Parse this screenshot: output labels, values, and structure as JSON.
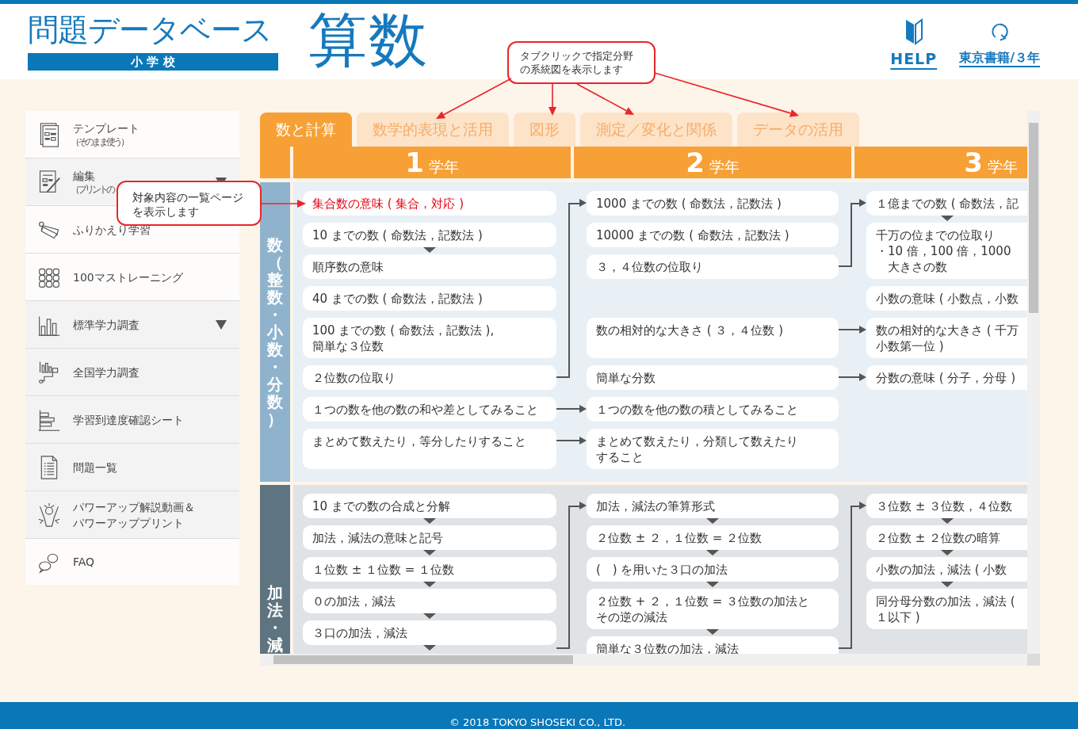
{
  "header": {
    "logo_title": "問題データベース",
    "logo_subtitle": "小 学 校",
    "subject": "算数",
    "links": [
      {
        "label": "HELP"
      },
      {
        "label": "東京書籍/３年"
      }
    ]
  },
  "sidebar": {
    "items": [
      {
        "label": "テンプレート",
        "sub": "（そのまま使う）",
        "highlighted": false,
        "expandable": false
      },
      {
        "label": "編集",
        "sub": "（プリントの",
        "highlighted": true,
        "expandable": true
      },
      {
        "label": "ふりかえり学習",
        "highlighted": false,
        "expandable": false
      },
      {
        "label": "100マストレーニング",
        "highlighted": false,
        "expandable": false
      },
      {
        "label": "標準学力調査",
        "highlighted": true,
        "expandable": true
      },
      {
        "label": "全国学力調査",
        "highlighted": true,
        "expandable": false
      },
      {
        "label": "学習到達度確認シート",
        "highlighted": true,
        "expandable": false
      },
      {
        "label": "問題一覧",
        "highlighted": true,
        "expandable": false
      },
      {
        "lines": [
          "パワーアップ解説動画＆",
          "パワーアッププリント"
        ],
        "highlighted": true,
        "expandable": false
      },
      {
        "label": "FAQ",
        "highlighted": false,
        "expandable": false
      }
    ]
  },
  "tabs": [
    {
      "label": "数と計算",
      "selected": true
    },
    {
      "label": "数学的表現と活用",
      "selected": false
    },
    {
      "label": "図形",
      "selected": false
    },
    {
      "label": "測定／変化と関係",
      "selected": false
    },
    {
      "label": "データの活用",
      "selected": false
    }
  ],
  "grades": [
    {
      "number": "1",
      "label": "学年"
    },
    {
      "number": "2",
      "label": "学年"
    },
    {
      "number": "3",
      "label": "学年"
    }
  ],
  "sections": [
    {
      "label": "数（整数・小数・分数）",
      "color": "#8fb3cc",
      "rows": [
        {
          "grade_1": [
            {
              "text": "集合数の意味 ( 集合，対応 )",
              "selected": true,
              "down": false
            }
          ],
          "grade_2": [
            {
              "text": "1000 までの数 ( 命数法，記数法 )",
              "selected": false,
              "down": false
            }
          ],
          "grade_3": [
            {
              "text": "１億までの数 ( 命数法，記",
              "selected": false,
              "down": true
            }
          ]
        },
        {
          "grade_1": [
            {
              "text": "10 までの数 ( 命数法，記数法 )",
              "selected": false,
              "down": true
            },
            {
              "text": "順序数の意味",
              "selected": false,
              "down": false
            }
          ],
          "grade_2": [
            {
              "text": "10000 までの数 ( 命数法，記数法 )",
              "selected": false,
              "down": false
            },
            {
              "text": "３，４位数の位取り",
              "selected": false,
              "down": false,
              "link": {
                "kind": "elbow"
              }
            }
          ],
          "grade_3": [
            {
              "lines": [
                "千万の位までの位取り",
                "・10 倍，100 倍，1000",
                "　大きさの数"
              ],
              "selected": false,
              "down": false
            }
          ]
        },
        {
          "grade_1": [
            {
              "text": "40 までの数 ( 命数法，記数法 )",
              "selected": false,
              "down": false
            }
          ],
          "grade_3": [
            {
              "text": "小数の意味 ( 小数点，小数",
              "selected": false,
              "down": false
            }
          ]
        },
        {
          "grade_1": [
            {
              "lines": [
                "100 までの数 ( 命数法，記数法 ),",
                "簡単な３位数"
              ],
              "selected": false,
              "down": false
            }
          ],
          "grade_2": [
            {
              "text": "数の相対的な大きさ ( ３，４位数 )",
              "selected": false,
              "down": false,
              "link": {
                "kind": "right"
              }
            }
          ],
          "grade_3": [
            {
              "lines": [
                "数の相対的な大きさ ( 千万",
                "小数第一位 )"
              ],
              "selected": false,
              "down": false
            }
          ]
        },
        {
          "grade_1": [
            {
              "text": "２位数の位取り",
              "selected": false,
              "down": false,
              "link": {
                "kind": "elbow"
              }
            }
          ],
          "grade_2": [
            {
              "text": "簡単な分数",
              "selected": false,
              "down": false,
              "link": {
                "kind": "right"
              }
            }
          ],
          "grade_3": [
            {
              "text": "分数の意味 ( 分子，分母 )",
              "selected": false,
              "down": false
            }
          ]
        },
        {
          "grade_1": [
            {
              "text": "１つの数を他の数の和や差としてみること",
              "selected": false,
              "down": false,
              "link": {
                "kind": "right"
              }
            }
          ],
          "grade_2": [
            {
              "text": "１つの数を他の数の積としてみること",
              "selected": false,
              "down": false
            }
          ]
        },
        {
          "grade_1": [
            {
              "text": "まとめて数えたり，等分したりすること",
              "selected": false,
              "down": false,
              "link": {
                "kind": "right"
              }
            }
          ],
          "grade_2": [
            {
              "lines": [
                "まとめて数えたり，分類して数えたり",
                "すること"
              ],
              "selected": false,
              "down": false
            }
          ]
        }
      ]
    },
    {
      "label": "加法・減",
      "color": "#5e7480",
      "rows": [
        {
          "grade_1": [
            {
              "text": "10 までの数の合成と分解",
              "selected": false,
              "down": true
            },
            {
              "text": "加法，減法の意味と記号",
              "selected": false,
              "down": true
            },
            {
              "text": "１位数 ± １位数 = １位数",
              "selected": false,
              "down": true
            },
            {
              "text": "０の加法，減法",
              "selected": false,
              "down": true
            },
            {
              "text": "３口の加法，減法",
              "selected": false,
              "down": true,
              "link": {
                "kind": "elbow"
              }
            }
          ],
          "grade_2": [
            {
              "text": "加法，減法の筆算形式",
              "selected": false,
              "down": true
            },
            {
              "text": "２位数 ± ２，１位数 = ２位数",
              "selected": false,
              "down": true
            },
            {
              "text": "(　) を用いた３口の加法",
              "selected": false,
              "down": true
            },
            {
              "lines": [
                "２位数 + ２，１位数 = ３位数の加法と",
                "その逆の減法"
              ],
              "selected": false,
              "down": true
            },
            {
              "text": "簡単な３位数の加法，減法",
              "selected": false,
              "down": false,
              "link": {
                "kind": "elbow"
              }
            }
          ],
          "grade_3": [
            {
              "text": "３位数 ± ３位数，４位数",
              "selected": false,
              "down": true
            },
            {
              "text": "２位数 ± ２位数の暗算",
              "selected": false,
              "down": true
            },
            {
              "text": "小数の加法，減法 ( 小数",
              "selected": false,
              "down": true
            },
            {
              "lines": [
                "同分母分数の加法，減法 (",
                "１以下 )"
              ],
              "selected": false,
              "down": false
            }
          ]
        }
      ]
    }
  ],
  "callouts": [
    {
      "lines": [
        "タブクリックで指定分野",
        "の系統図を表示します"
      ]
    },
    {
      "lines": [
        "対象内容の一覧ページ",
        "を表示します"
      ]
    }
  ],
  "footer": {
    "copyright": "© 2018 TOKYO SHOSEKI CO., LTD."
  }
}
